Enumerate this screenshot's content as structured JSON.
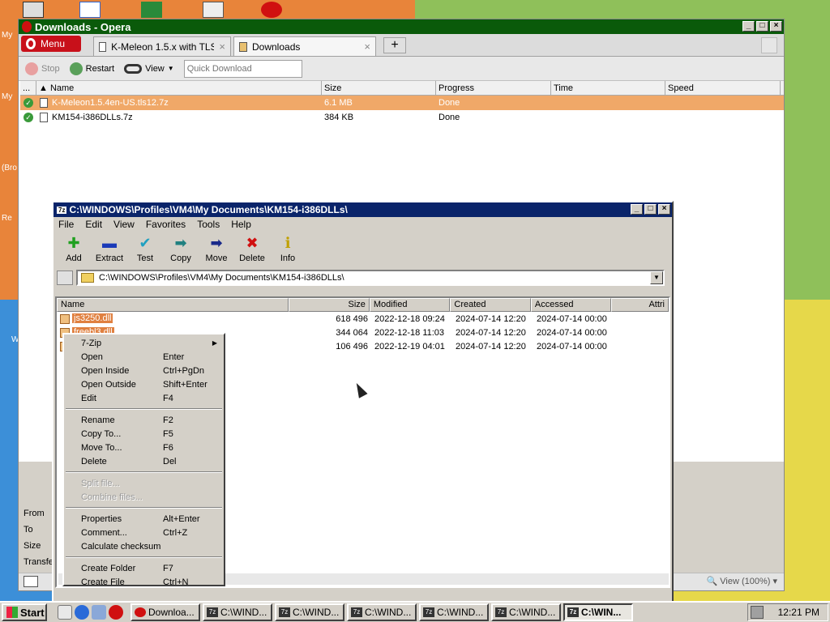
{
  "desktop": {
    "labels": [
      "My",
      "My",
      "(Bro",
      "Re",
      "W"
    ],
    "colors": {
      "orange": "#e8843a",
      "green": "#8fc05a",
      "blue": "#3c8fd8",
      "yellow": "#e6d84a"
    }
  },
  "opera": {
    "title": "Downloads - Opera",
    "menu_label": "Menu",
    "tabs": [
      {
        "label": "K-Meleon 1.5.x with TLS ..."
      },
      {
        "label": "Downloads"
      }
    ],
    "toolbar": {
      "stop": "Stop",
      "restart": "Restart",
      "view": "View",
      "quick_download_placeholder": "Quick Download"
    },
    "columns": [
      "...",
      "Name",
      "Size",
      "Progress",
      "Time",
      "Speed"
    ],
    "downloads": [
      {
        "name": "K-Meleon1.5.4en-US.tls12.7z",
        "size": "6.1 MB",
        "progress": "Done",
        "selected": true
      },
      {
        "name": "KM154-i386DLLs.7z",
        "size": "384 KB",
        "progress": "Done",
        "selected": false
      }
    ],
    "details_labels": [
      "From",
      "To",
      "Size",
      "Transfe"
    ],
    "zoom": "View (100%)"
  },
  "zip": {
    "title": "C:\\WINDOWS\\Profiles\\VM4\\My Documents\\KM154-i386DLLs\\",
    "menu": [
      "File",
      "Edit",
      "View",
      "Favorites",
      "Tools",
      "Help"
    ],
    "toolbar": [
      {
        "label": "Add",
        "icon": "plus-icon"
      },
      {
        "label": "Extract",
        "icon": "minus-icon"
      },
      {
        "label": "Test",
        "icon": "check-icon"
      },
      {
        "label": "Copy",
        "icon": "copy-arrow-icon"
      },
      {
        "label": "Move",
        "icon": "move-arrow-icon"
      },
      {
        "label": "Delete",
        "icon": "delete-x-icon"
      },
      {
        "label": "Info",
        "icon": "info-icon"
      }
    ],
    "address": "C:\\WINDOWS\\Profiles\\VM4\\My Documents\\KM154-i386DLLs\\",
    "columns": [
      "Name",
      "Size",
      "Modified",
      "Created",
      "Accessed",
      "Attri"
    ],
    "files": [
      {
        "name": "js3250.dll",
        "size": "618 496",
        "modified": "2022-12-18 09:24",
        "created": "2024-07-14 12:20",
        "accessed": "2024-07-14 00:00"
      },
      {
        "name": "freebl3.dll",
        "size": "344 064",
        "modified": "2022-12-18 11:03",
        "created": "2024-07-14 12:20",
        "accessed": "2024-07-14 00:00"
      },
      {
        "name": "",
        "size": "106 496",
        "modified": "2022-12-19 04:01",
        "created": "2024-07-14 12:20",
        "accessed": "2024-07-14 00:00"
      }
    ]
  },
  "context_menu": {
    "items": [
      {
        "label": "7-Zip",
        "key": "",
        "submenu": true
      },
      {
        "label": "Open",
        "key": "Enter"
      },
      {
        "label": "Open Inside",
        "key": "Ctrl+PgDn"
      },
      {
        "label": "Open Outside",
        "key": "Shift+Enter"
      },
      {
        "label": "Edit",
        "key": "F4"
      },
      {
        "sep": true
      },
      {
        "label": "Rename",
        "key": "F2"
      },
      {
        "label": "Copy To...",
        "key": "F5"
      },
      {
        "label": "Move To...",
        "key": "F6"
      },
      {
        "label": "Delete",
        "key": "Del"
      },
      {
        "sep": true
      },
      {
        "label": "Split file...",
        "key": "",
        "disabled": true
      },
      {
        "label": "Combine files...",
        "key": "",
        "disabled": true
      },
      {
        "sep": true
      },
      {
        "label": "Properties",
        "key": "Alt+Enter"
      },
      {
        "label": "Comment...",
        "key": "Ctrl+Z"
      },
      {
        "label": "Calculate checksum",
        "key": ""
      },
      {
        "sep": true
      },
      {
        "label": "Create Folder",
        "key": "F7"
      },
      {
        "label": "Create File",
        "key": "Ctrl+N"
      }
    ]
  },
  "taskbar": {
    "start": "Start",
    "tasks": [
      "Downloa...",
      "C:\\WIND...",
      "C:\\WIND...",
      "C:\\WIND...",
      "C:\\WIND...",
      "C:\\WIND...",
      "C:\\WIN..."
    ],
    "clock": "12:21 PM"
  }
}
